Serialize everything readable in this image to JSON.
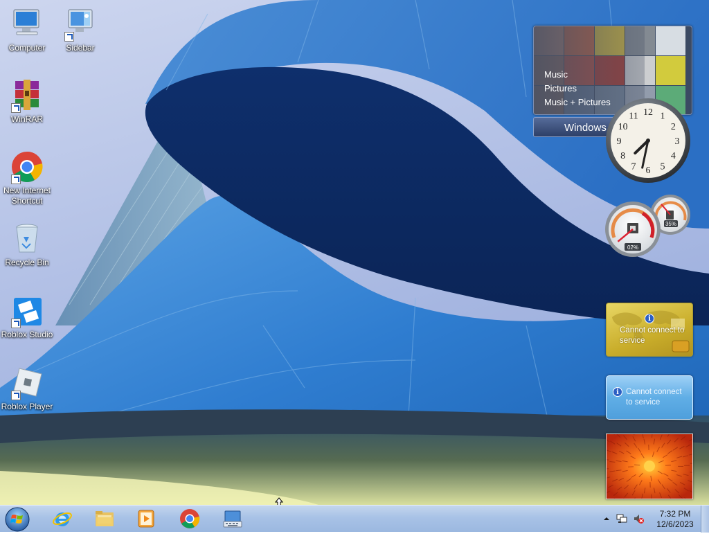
{
  "desktop": {
    "icons": [
      {
        "label": "Computer",
        "icon": "computer-icon",
        "shortcut": false
      },
      {
        "label": "Sidebar",
        "icon": "sidebar-icon",
        "shortcut": true
      },
      {
        "label": "WinRAR",
        "icon": "winrar-icon",
        "shortcut": true
      },
      {
        "label": "New Internet Shortcut",
        "icon": "chrome-icon",
        "shortcut": true
      },
      {
        "label": "Recycle Bin",
        "icon": "recycle-bin-icon",
        "shortcut": false
      },
      {
        "label": "Roblox Studio",
        "icon": "roblox-studio-icon",
        "shortcut": true
      },
      {
        "label": "Roblox Player",
        "icon": "roblox-player-icon",
        "shortcut": true
      }
    ]
  },
  "gadgets": {
    "media_center": {
      "menu": [
        "Music",
        "Pictures",
        "Music + Pictures"
      ],
      "footer": "Windows"
    },
    "clock": {
      "hour": 7,
      "minute": 32
    },
    "cpu_meter": {
      "cpu": "02%",
      "memory": "35%",
      "cpu_value": 2,
      "memory_value": 35
    },
    "weather": {
      "message": "Cannot connect to service",
      "info": "i"
    },
    "feed": {
      "message": "Cannot connect to service",
      "info": "i"
    },
    "slideshow": {
      "subject": "orange chrysanthemum"
    }
  },
  "taskbar": {
    "start_icon": "windows-orb-icon",
    "pinned": [
      {
        "name": "internet-explorer",
        "icon": "internet-explorer-icon"
      },
      {
        "name": "windows-explorer",
        "icon": "folder-icon"
      },
      {
        "name": "media-player",
        "icon": "media-player-icon"
      },
      {
        "name": "chrome",
        "icon": "chrome-icon"
      },
      {
        "name": "on-screen-keyboard",
        "icon": "keyboard-icon"
      }
    ],
    "tray": {
      "time": "7:32 PM",
      "date": "12/6/2023",
      "icons": [
        "show-hidden-icons-arrow",
        "network-icon",
        "volume-muted-icon"
      ]
    }
  },
  "colors": {
    "taskbar": "#a8c2e6",
    "wallpaper_blue": "#1d5fb5",
    "weather_gold": "#c9ad2a",
    "feed_blue": "#60aee6"
  }
}
